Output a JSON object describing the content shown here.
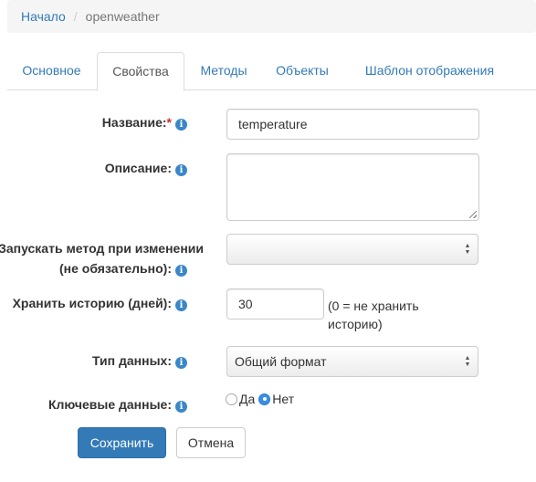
{
  "breadcrumb": {
    "home": "Начало",
    "separator": "/",
    "current": "openweather"
  },
  "tabs": [
    {
      "label": "Основное",
      "active": false
    },
    {
      "label": "Свойства",
      "active": true
    },
    {
      "label": "Методы",
      "active": false
    },
    {
      "label": "Объекты",
      "active": false
    },
    {
      "label": "Шаблон отображения",
      "active": false
    }
  ],
  "form": {
    "name_label": "Название:",
    "required_mark": "*",
    "name_value": "temperature",
    "description_label": "Описание:",
    "description_value": "",
    "method_label_line1": "Запускать метод при изменении",
    "method_label_line2": "(не обязательно):",
    "method_value": "",
    "history_label": "Хранить историю (дней):",
    "history_value": "30",
    "history_hint": "(0 = не хранить историю)",
    "datatype_label": "Тип данных:",
    "datatype_value": "Общий формат",
    "key_label": "Ключевые данные:",
    "key_options": [
      {
        "label": "Да",
        "checked": false
      },
      {
        "label": "Нет",
        "checked": true
      }
    ]
  },
  "buttons": {
    "save": "Сохранить",
    "cancel": "Отмена"
  },
  "icons": {
    "info_glyph": "i"
  },
  "colors": {
    "link": "#337ab7",
    "primary": "#337ab7",
    "required": "#c9302c",
    "info": "#3a87c8"
  }
}
